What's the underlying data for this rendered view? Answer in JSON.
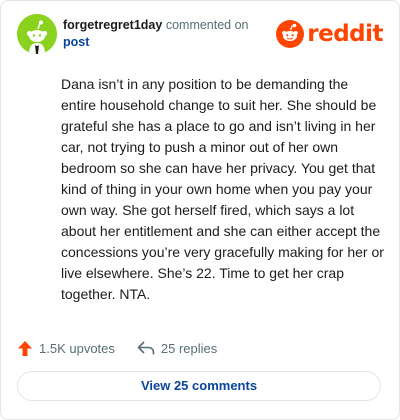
{
  "comment": {
    "username": "forgetregret1day",
    "action_text": "commented on",
    "target_link": "post",
    "body": "Dana isn’t in any position to be demanding the entire household change to suit her. She should be grateful she has a place to go and isn’t living in her car, not trying to push a minor out of her own bedroom so she can have her privacy. You get that kind of thing in your own home when you pay your own way. She got herself fired, which says a lot about her entitlement and she can either accept the concessions you’re very gracefully making for her or live elsewhere. She’s 22. Time to get her crap together. NTA."
  },
  "brand": {
    "name": "reddit",
    "color": "#ff4500",
    "icon": "reddit-snoo-icon"
  },
  "avatar": {
    "icon": "snoo-avatar-icon",
    "color": "#8ad21d"
  },
  "actions": {
    "upvotes_label": "1.5K upvotes",
    "upvote_icon": "upvote-arrow-icon",
    "upvote_color": "#ff4500",
    "replies_label": "25 replies",
    "reply_icon": "reply-arrow-icon"
  },
  "footer": {
    "view_comments_label": "View 25 comments",
    "link_color": "#0a449b"
  }
}
